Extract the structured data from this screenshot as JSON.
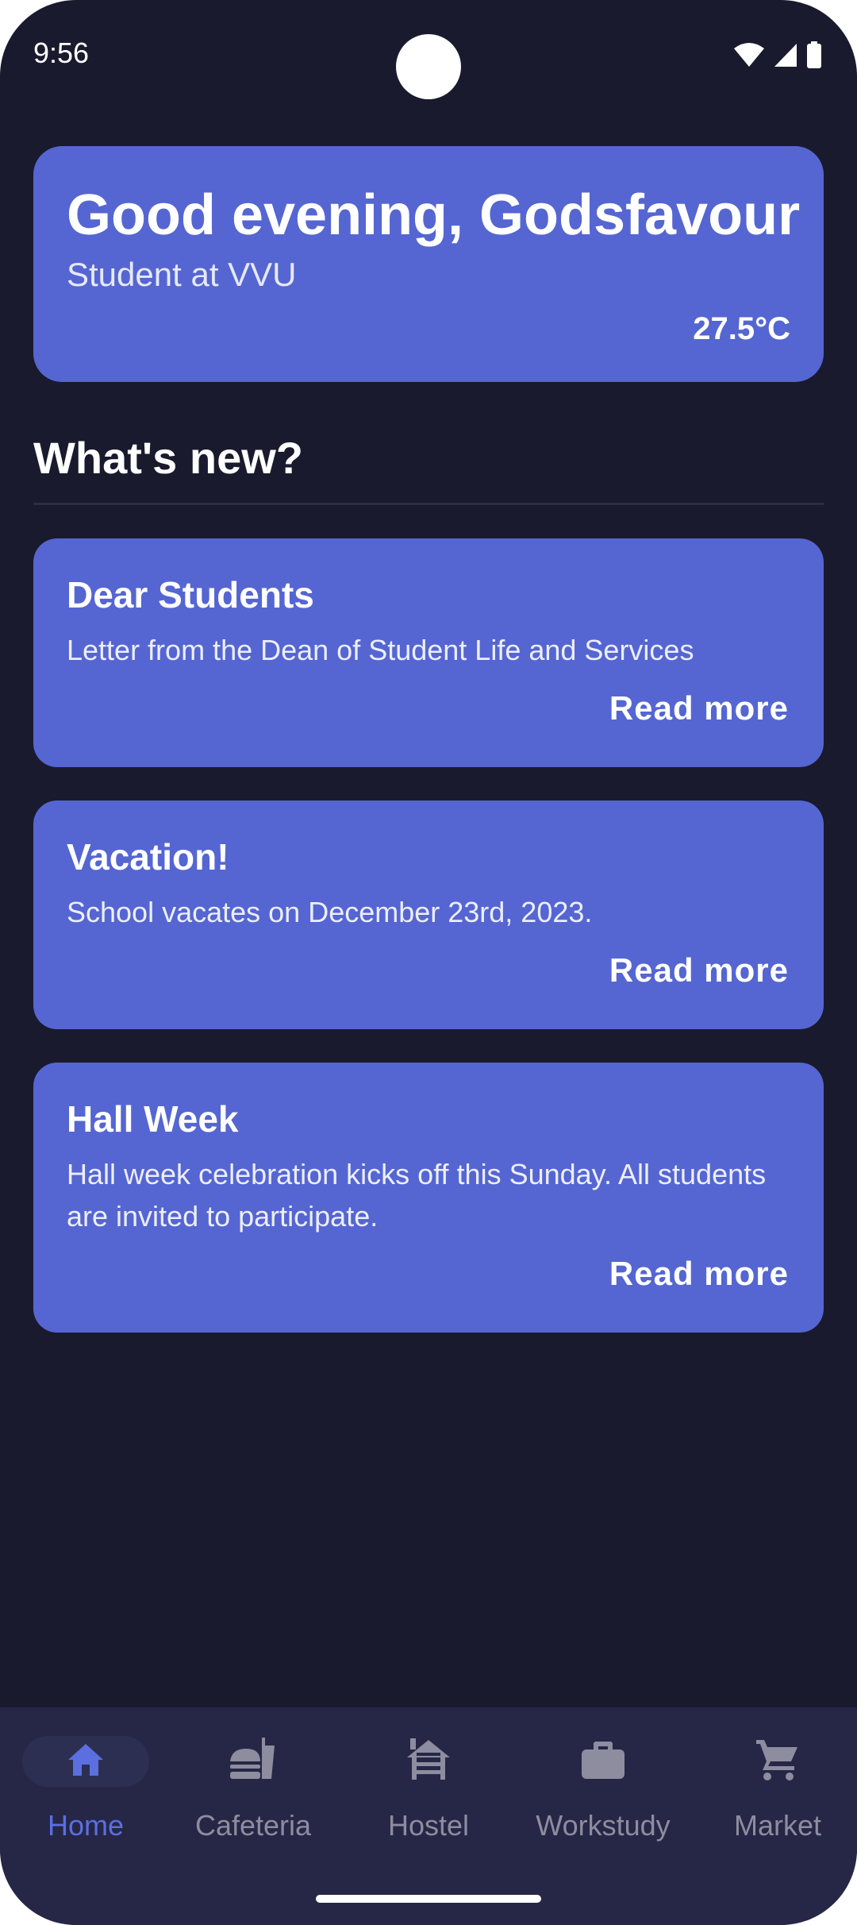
{
  "status_bar": {
    "time": "9:56",
    "icons": [
      "wifi-icon",
      "signal-icon",
      "battery-icon"
    ]
  },
  "header": {
    "greeting": "Good evening, Godsfavour",
    "subtitle": "Student at VVU",
    "temperature": "27.5°C"
  },
  "section": {
    "title": "What's new?"
  },
  "news": [
    {
      "title": "Dear Students",
      "body": "Letter from the Dean of Student Life and Services",
      "action": "Read more"
    },
    {
      "title": "Vacation!",
      "body": "School vacates on December 23rd, 2023.",
      "action": "Read more"
    },
    {
      "title": "Hall Week",
      "body": "Hall week celebration kicks off this Sunday. All students are invited to participate.",
      "action": "Read more"
    }
  ],
  "bottom_nav": {
    "items": [
      {
        "label": "Home",
        "icon": "home-icon",
        "active": true
      },
      {
        "label": "Cafeteria",
        "icon": "fastfood-icon",
        "active": false
      },
      {
        "label": "Hostel",
        "icon": "house-siding-icon",
        "active": false
      },
      {
        "label": "Workstudy",
        "icon": "briefcase-icon",
        "active": false
      },
      {
        "label": "Market",
        "icon": "shopping-cart-icon",
        "active": false
      }
    ]
  },
  "colors": {
    "background": "#1a1a2e",
    "card": "#5566d2",
    "nav_background": "#262747",
    "nav_active": "#5b6fe0",
    "nav_inactive": "#8d8d9f"
  }
}
